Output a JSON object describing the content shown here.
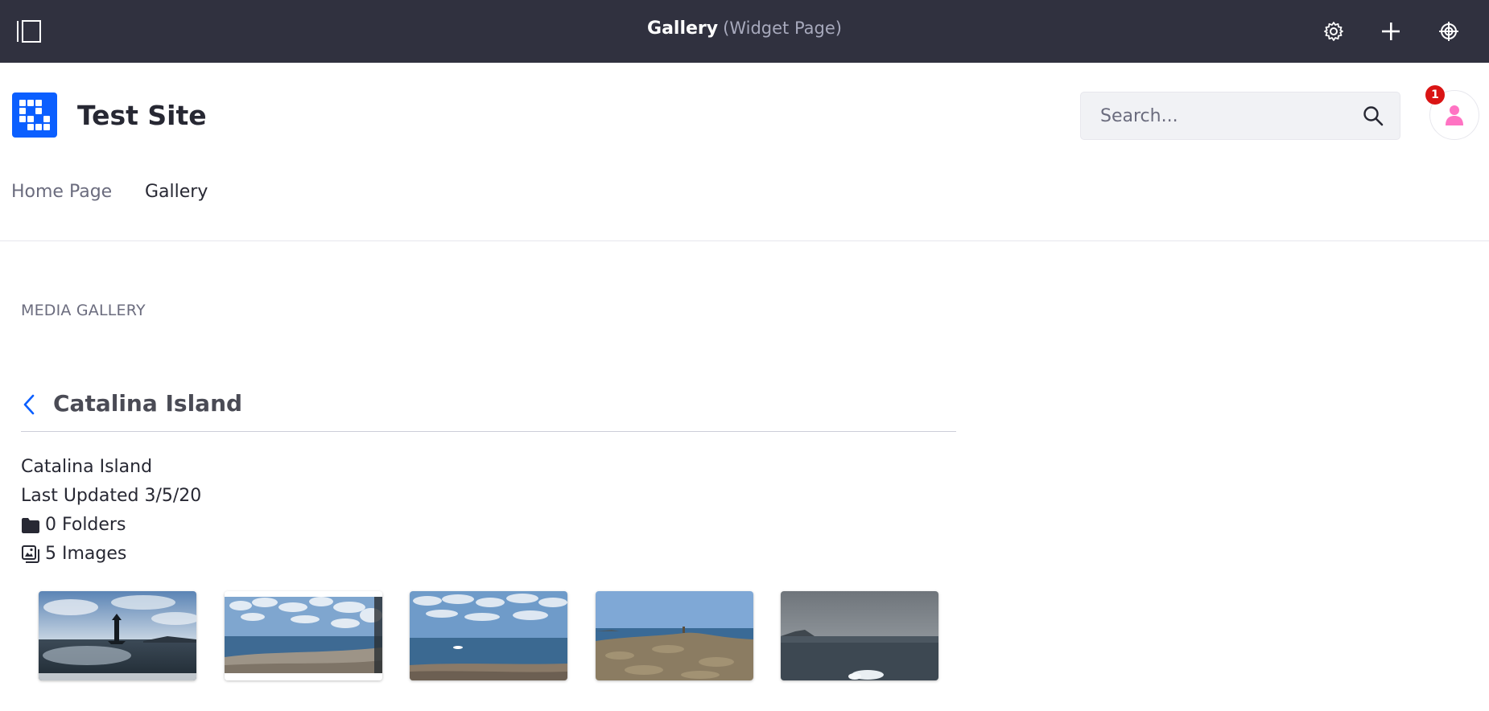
{
  "control_bar": {
    "title": "Gallery",
    "subtitle": "(Widget Page)",
    "icons": [
      "sidebar-toggle-icon",
      "gear-icon",
      "plus-icon",
      "target-icon"
    ],
    "background": "#30313f"
  },
  "header": {
    "site_name": "Test Site",
    "logo_color": "#0b5fff",
    "search": {
      "placeholder": "Search...",
      "value": ""
    },
    "notifications_count": "1",
    "avatar_color": "#ff73c3"
  },
  "nav": {
    "items": [
      {
        "label": "Home Page",
        "active": false
      },
      {
        "label": "Gallery",
        "active": true
      }
    ]
  },
  "portlet": {
    "title": "MEDIA GALLERY",
    "folder": {
      "title": "Catalina Island",
      "description": "Catalina Island",
      "last_updated": "Last Updated 3/5/20",
      "folders_count": "0 Folders",
      "images_count": "5 Images"
    },
    "images": [
      {
        "subject": "lighthouse-on-water"
      },
      {
        "subject": "beach-with-clouds"
      },
      {
        "subject": "shoreline-sea"
      },
      {
        "subject": "rocky-point"
      },
      {
        "subject": "overcast-cliff-sea"
      }
    ]
  },
  "colors": {
    "accent": "#0b5fff",
    "badge": "#da1414",
    "text": "#272833",
    "muted": "#6b6c7e"
  }
}
